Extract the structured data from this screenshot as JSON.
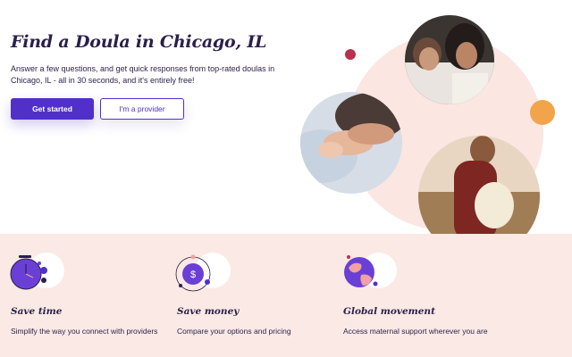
{
  "hero": {
    "title": "Find a Doula in Chicago, IL",
    "subtitle": "Answer a few questions, and get quick responses from top-rated doulas in Chicago, IL - all in 30 seconds, and it's entirely free!",
    "primary_button": "Get started",
    "secondary_button": "I'm a provider"
  },
  "features": [
    {
      "icon": "stopwatch-icon",
      "title": "Save time",
      "description": "Simplify the way you connect with providers"
    },
    {
      "icon": "dollar-coin-icon",
      "title": "Save money",
      "description": "Compare your options and pricing"
    },
    {
      "icon": "globe-icon",
      "title": "Global movement",
      "description": "Access maternal support wherever you are"
    }
  ],
  "colors": {
    "accent": "#5130c9",
    "text": "#2a1f4a",
    "blush": "#fae9e4",
    "dot_red": "#b8324e",
    "dot_orange": "#f2a44a"
  }
}
